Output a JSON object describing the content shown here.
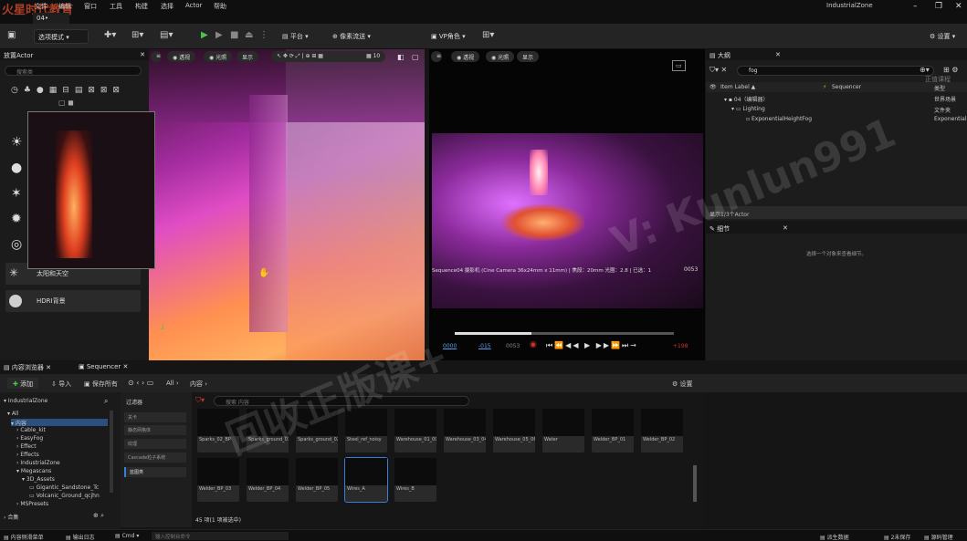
{
  "app": {
    "logo": "火星时代教育",
    "project": "IndustrialZone",
    "tab": "04•"
  },
  "menu": [
    "文件",
    "编辑",
    "窗口",
    "工具",
    "构建",
    "选择",
    "Actor",
    "帮助"
  ],
  "toolbar": {
    "mode": "选项模式",
    "platform": "平台",
    "render": "像素流送",
    "vp": "VP角色",
    "settings": "设置"
  },
  "left_panel": {
    "title": "放置Actor",
    "search_placeholder": "搜索类",
    "items": [
      {
        "label": "太阳和天空",
        "icon": "sun-icon"
      },
      {
        "label": "HDRI背景",
        "icon": "hdri-icon"
      }
    ]
  },
  "viewport1": {
    "persp": "透视",
    "lit": "光照",
    "show": "显示",
    "grid": "10"
  },
  "viewport2": {
    "persp": "透视",
    "lit": "光照",
    "show": "显示",
    "info": "Sequence04 摄影机 (Cine Camera 36x24mm x 11mm) | 焦段：20mm  光圈：2.8  | 已选：1",
    "frame": "0053",
    "time_start": "0000",
    "time_a": "-015",
    "time_b": "0053",
    "time_end": "+198"
  },
  "outliner": {
    "title": "大纲",
    "search_value": "fog",
    "col_label": "Item Label ▲",
    "col_type": "类型",
    "col_seq": "Sequencer",
    "rows": [
      {
        "label": "04（编辑器）",
        "type": "世界场景"
      },
      {
        "label": "Lighting",
        "type": "文件夹"
      },
      {
        "label": "ExponentialHeightFog",
        "type": "Exponential"
      }
    ],
    "footer": "显示1/3个Actor",
    "watermark_small": "正值课程"
  },
  "details": {
    "title": "细节",
    "empty": "选择一个对象来查看细节。"
  },
  "content_browser": {
    "tab1": "内容浏览器",
    "tab2": "Sequencer",
    "add": "添加",
    "import": "导入",
    "save_all": "保存所有",
    "path_all": "All",
    "path_content": "内容",
    "settings": "设置",
    "filter_title": "过滤器",
    "search_placeholder": "搜索 内容",
    "filters": [
      "关卡",
      "静态网格体",
      "纹理",
      "Cascade粒子系统",
      "蓝图类"
    ],
    "tree": [
      "IndustrialZone",
      "All",
      "内容",
      "Cable_kit",
      "EasyFog",
      "Effect",
      "Effects",
      "IndustrialZone",
      "Megascans",
      "3D_Assets",
      "Gigantic_Sandstone_Tc",
      "Volcanic_Ground_qcjhn",
      "MSPresets"
    ],
    "tree_footer": "合集",
    "assets_row1": [
      "Sparks_02_BP",
      "Sparks_ground_03_BP",
      "Sparks_ground_02_BP",
      "Steel_ref_noisy",
      "Warehouse_01_00",
      "Warehouse_03_04",
      "Warehouse_05_06",
      "Water",
      "Welder_BP_01",
      "Welder_BP_02"
    ],
    "assets_row2": [
      "Welder_BP_03",
      "Welder_BP_04",
      "Welder_BP_05",
      "Wires_A",
      "Wires_B"
    ],
    "count": "45 项(1 项被选中)"
  },
  "status": {
    "cb": "内容侧滑菜单",
    "log": "输出日志",
    "cmd": "Cmd",
    "cmd_placeholder": "输入控制台命令",
    "derived": "派生数据",
    "unsaved": "2未保存",
    "source": "源码管理"
  },
  "watermarks": {
    "w1": "V: Kunlun991",
    "w2": "回收正版课+"
  }
}
